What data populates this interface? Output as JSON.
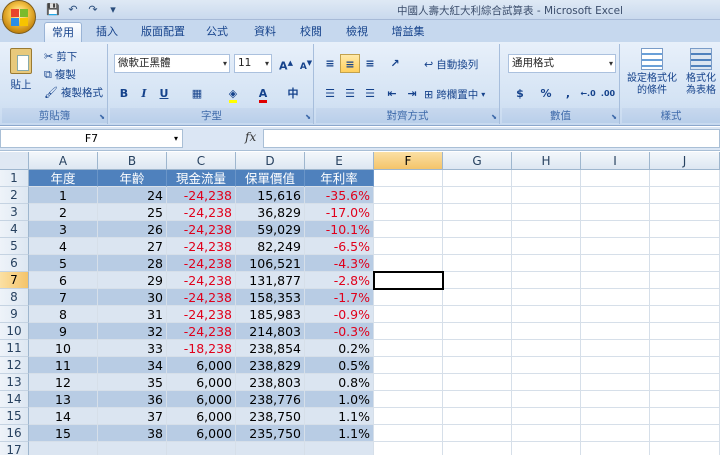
{
  "window": {
    "title": "中國人壽大紅大利綜合試算表 - Microsoft Excel"
  },
  "qat": {
    "save": "💾",
    "undo": "↶",
    "redo": "↷",
    "customize": "▾"
  },
  "ribbon_tabs": [
    "常用",
    "插入",
    "版面配置",
    "公式",
    "資料",
    "校閱",
    "檢視",
    "增益集"
  ],
  "ribbon": {
    "clipboard": {
      "paste_label": "貼上",
      "cut_label": "剪下",
      "copy_label": "複製",
      "format_painter_label": "複製格式",
      "group_label": "剪貼簿"
    },
    "font": {
      "font_name": "微軟正黑體",
      "font_size": "11",
      "grow_label": "A",
      "shrink_label": "A",
      "bold": "B",
      "italic": "I",
      "underline": "U",
      "font_color_label": "A",
      "phonetic_label": "中",
      "group_label": "字型"
    },
    "alignment": {
      "wrap_label": "自動換列",
      "merge_label": "跨欄置中",
      "group_label": "對齊方式"
    },
    "number": {
      "format": "通用格式",
      "currency": "$",
      "percent": "%",
      "comma": ",",
      "inc_decimal": "←.0",
      "dec_decimal": ".00",
      "group_label": "數值"
    },
    "styles": {
      "conditional_label": "設定格式化的條件",
      "table_label": "格式化為表格",
      "group_label": "樣式"
    }
  },
  "formula_bar": {
    "name_box": "F7",
    "fx": "fx",
    "value": ""
  },
  "columns": [
    "A",
    "B",
    "C",
    "D",
    "E",
    "F",
    "G",
    "H",
    "I",
    "J"
  ],
  "selected_column": "F",
  "selected_row": 7,
  "table": {
    "headers": [
      "年度",
      "年齡",
      "現金流量",
      "保單價值",
      "年利率"
    ],
    "rows": [
      {
        "year": "1",
        "age": "24",
        "cashflow": "-24,238",
        "value": "15,616",
        "rate": "-35.6%",
        "neg_cf": true,
        "neg_rate": true
      },
      {
        "year": "2",
        "age": "25",
        "cashflow": "-24,238",
        "value": "36,829",
        "rate": "-17.0%",
        "neg_cf": true,
        "neg_rate": true
      },
      {
        "year": "3",
        "age": "26",
        "cashflow": "-24,238",
        "value": "59,029",
        "rate": "-10.1%",
        "neg_cf": true,
        "neg_rate": true
      },
      {
        "year": "4",
        "age": "27",
        "cashflow": "-24,238",
        "value": "82,249",
        "rate": "-6.5%",
        "neg_cf": true,
        "neg_rate": true
      },
      {
        "year": "5",
        "age": "28",
        "cashflow": "-24,238",
        "value": "106,521",
        "rate": "-4.3%",
        "neg_cf": true,
        "neg_rate": true
      },
      {
        "year": "6",
        "age": "29",
        "cashflow": "-24,238",
        "value": "131,877",
        "rate": "-2.8%",
        "neg_cf": true,
        "neg_rate": true
      },
      {
        "year": "7",
        "age": "30",
        "cashflow": "-24,238",
        "value": "158,353",
        "rate": "-1.7%",
        "neg_cf": true,
        "neg_rate": true
      },
      {
        "year": "8",
        "age": "31",
        "cashflow": "-24,238",
        "value": "185,983",
        "rate": "-0.9%",
        "neg_cf": true,
        "neg_rate": true
      },
      {
        "year": "9",
        "age": "32",
        "cashflow": "-24,238",
        "value": "214,803",
        "rate": "-0.3%",
        "neg_cf": true,
        "neg_rate": true
      },
      {
        "year": "10",
        "age": "33",
        "cashflow": "-18,238",
        "value": "238,854",
        "rate": "0.2%",
        "neg_cf": true,
        "neg_rate": false
      },
      {
        "year": "11",
        "age": "34",
        "cashflow": "6,000",
        "value": "238,829",
        "rate": "0.5%",
        "neg_cf": false,
        "neg_rate": false
      },
      {
        "year": "12",
        "age": "35",
        "cashflow": "6,000",
        "value": "238,803",
        "rate": "0.8%",
        "neg_cf": false,
        "neg_rate": false
      },
      {
        "year": "13",
        "age": "36",
        "cashflow": "6,000",
        "value": "238,776",
        "rate": "1.0%",
        "neg_cf": false,
        "neg_rate": false
      },
      {
        "year": "14",
        "age": "37",
        "cashflow": "6,000",
        "value": "238,750",
        "rate": "1.1%",
        "neg_cf": false,
        "neg_rate": false
      },
      {
        "year": "15",
        "age": "38",
        "cashflow": "6,000",
        "value": "235,750",
        "rate": "1.1%",
        "neg_cf": false,
        "neg_rate": false
      }
    ]
  },
  "row_numbers": [
    "1",
    "2",
    "3",
    "4",
    "5",
    "6",
    "7",
    "8",
    "9",
    "10",
    "11",
    "12",
    "13",
    "14",
    "15",
    "16",
    "17"
  ],
  "colors": {
    "header_fill": "#4f81bd",
    "band_dark": "#b8cce4",
    "band_light": "#dbe5f1",
    "negative": "#e0001b"
  }
}
